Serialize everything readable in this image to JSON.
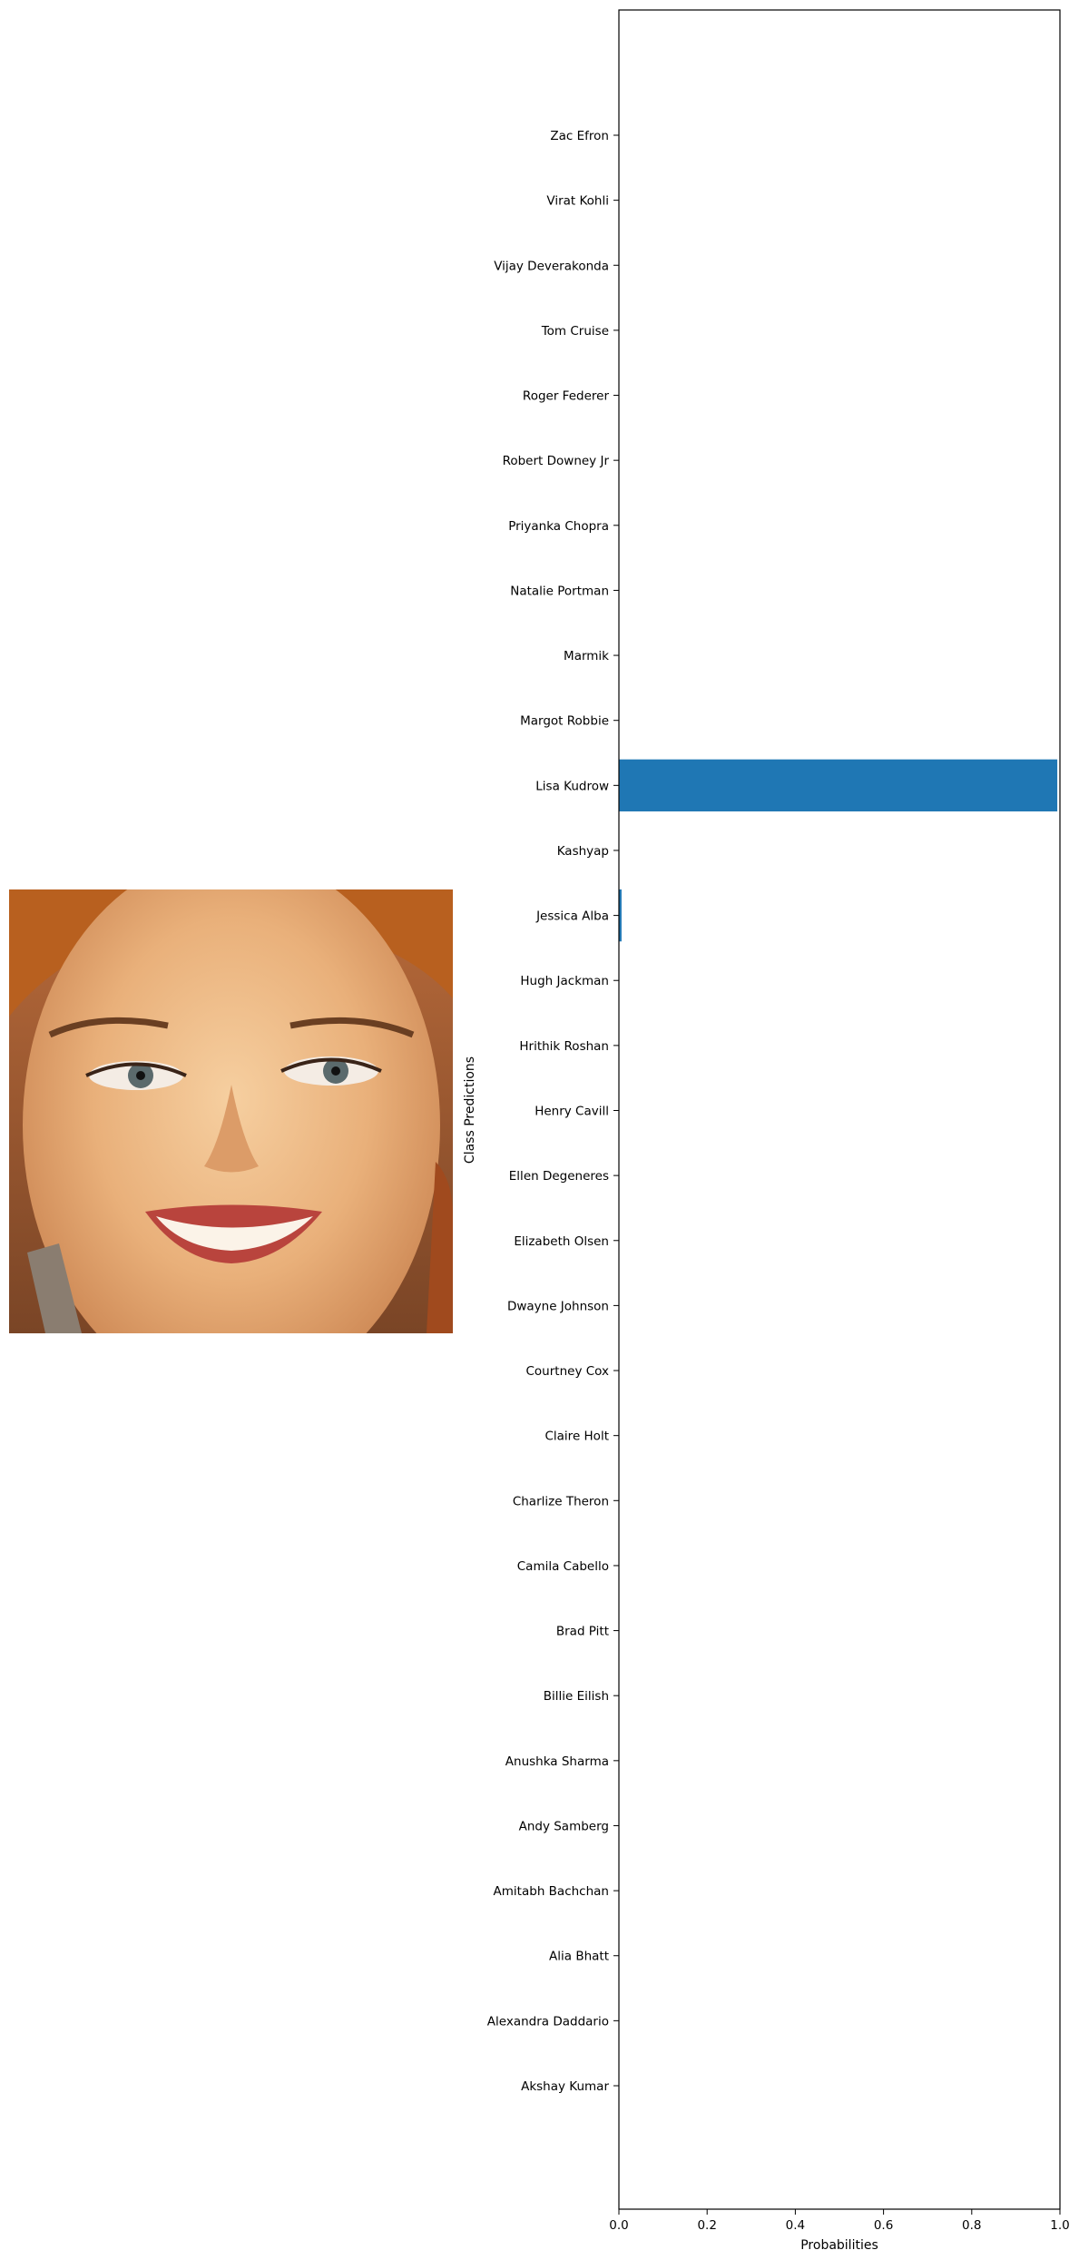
{
  "chart_data": {
    "type": "bar",
    "orientation": "horizontal",
    "xlabel": "Probabilities",
    "ylabel": "Class Predictions",
    "xlim": [
      0,
      1
    ],
    "x_ticks": [
      "0.0",
      "0.2",
      "0.4",
      "0.6",
      "0.8",
      "1.0"
    ],
    "bar_color": "#1f77b4",
    "categories": [
      "Akshay Kumar",
      "Alexandra Daddario",
      "Alia Bhatt",
      "Amitabh Bachchan",
      "Andy Samberg",
      "Anushka Sharma",
      "Billie Eilish",
      "Brad Pitt",
      "Camila Cabello",
      "Charlize Theron",
      "Claire Holt",
      "Courtney Cox",
      "Dwayne Johnson",
      "Elizabeth Olsen",
      "Ellen Degeneres",
      "Henry Cavill",
      "Hrithik Roshan",
      "Hugh Jackman",
      "Jessica Alba",
      "Kashyap",
      "Lisa Kudrow",
      "Margot Robbie",
      "Marmik",
      "Natalie Portman",
      "Priyanka Chopra",
      "Robert Downey Jr",
      "Roger Federer",
      "Tom Cruise",
      "Vijay Deverakonda",
      "Virat Kohli",
      "Zac Efron"
    ],
    "values": [
      0,
      0,
      0,
      0,
      0,
      0,
      0,
      0,
      0,
      0,
      0,
      0,
      0,
      0,
      0,
      0,
      0,
      0,
      0.006,
      0,
      0.994,
      0,
      0,
      0,
      0,
      0,
      0,
      0,
      0,
      0,
      0
    ]
  }
}
